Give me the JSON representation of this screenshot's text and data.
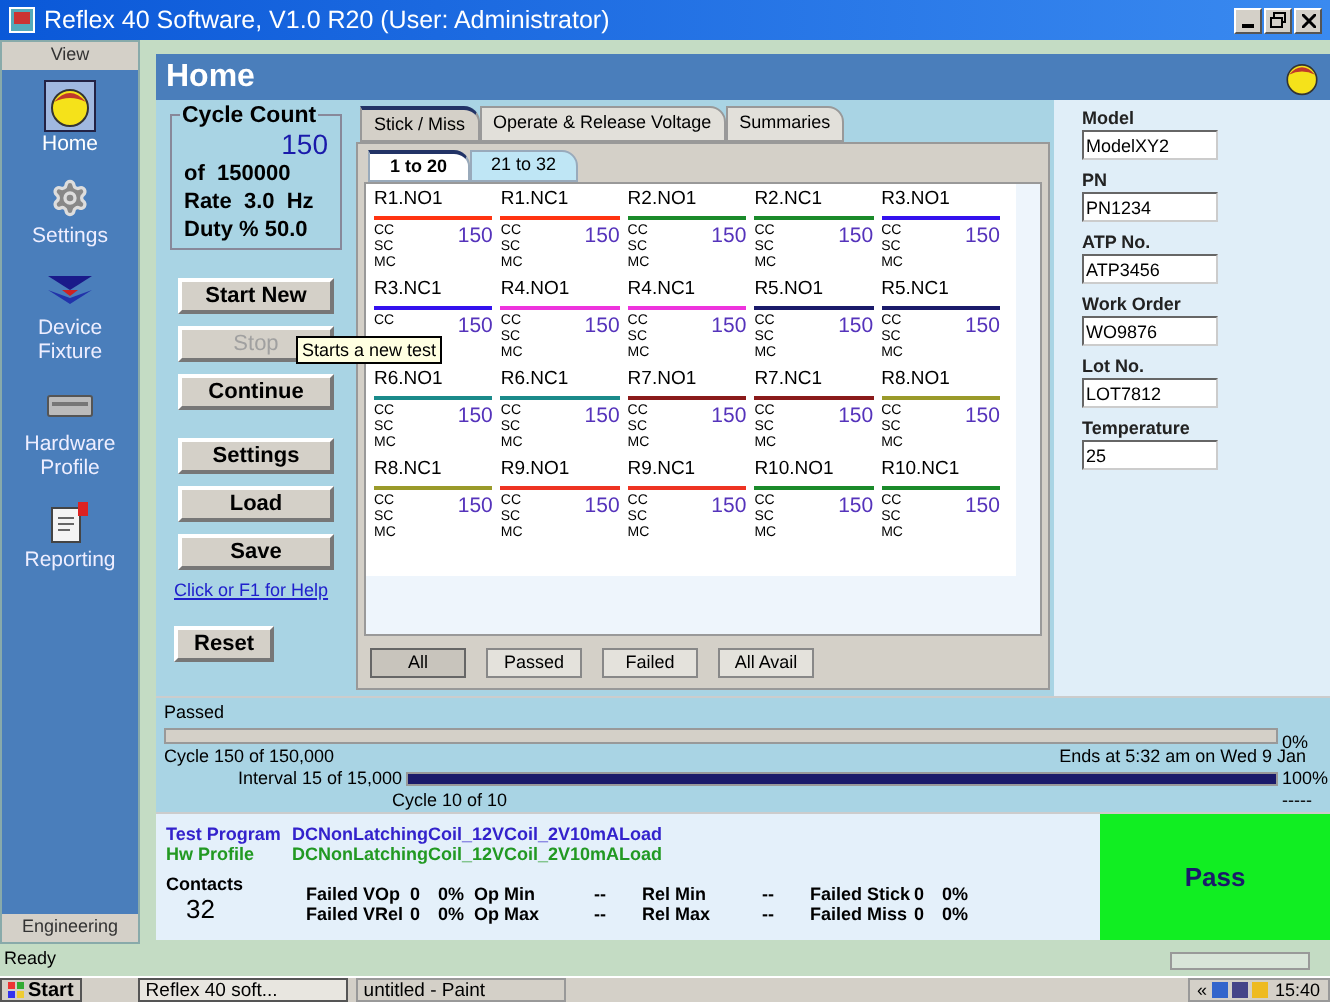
{
  "window": {
    "title": "Reflex 40 Software, V1.0 R20 (User: Administrator)"
  },
  "sidebar": {
    "header": "View",
    "items": [
      {
        "label": "Home",
        "kind": "head",
        "selected": true
      },
      {
        "label": "Settings",
        "kind": "gear",
        "selected": false
      },
      {
        "label": "Device Fixture",
        "kind": "fixture",
        "selected": false
      },
      {
        "label": "Hardware Profile",
        "kind": "hardware",
        "selected": false
      },
      {
        "label": "Reporting",
        "kind": "report",
        "selected": false
      }
    ],
    "footer": "Engineering"
  },
  "page_title": "Home",
  "cycle_count": {
    "title": "Cycle Count",
    "value": "150",
    "of": "of  150000",
    "rate": "Rate  3.0  Hz",
    "duty": "Duty % 50.0"
  },
  "run_buttons": [
    {
      "label": "Start New",
      "disabled": false
    },
    {
      "label": "Stop",
      "disabled": true
    },
    {
      "label": "Continue",
      "disabled": false
    }
  ],
  "file_buttons": [
    {
      "label": "Settings",
      "disabled": false
    },
    {
      "label": "Load",
      "disabled": false
    },
    {
      "label": "Save",
      "disabled": false
    }
  ],
  "help_link": "Click or F1 for Help",
  "reset_button": "Reset",
  "tooltip": "Starts a new test",
  "tabs": [
    {
      "label": "Stick / Miss",
      "selected": true
    },
    {
      "label": "Operate & Release Voltage",
      "selected": false
    },
    {
      "label": "Summaries",
      "selected": false
    }
  ],
  "subtabs": [
    {
      "label": "1 to 20",
      "selected": true
    },
    {
      "label": "21 to 32",
      "selected": false
    }
  ],
  "contacts": [
    {
      "name": "R1.NO1",
      "color": "#ff3311",
      "value": "150",
      "labels": [
        "CC",
        "SC",
        "MC"
      ]
    },
    {
      "name": "R1.NC1",
      "color": "#ff3311",
      "value": "150",
      "labels": [
        "CC",
        "SC",
        "MC"
      ]
    },
    {
      "name": "R2.NO1",
      "color": "#1a8a2a",
      "value": "150",
      "labels": [
        "CC",
        "SC",
        "MC"
      ]
    },
    {
      "name": "R2.NC1",
      "color": "#1a8a2a",
      "value": "150",
      "labels": [
        "CC",
        "SC",
        "MC"
      ]
    },
    {
      "name": "R3.NO1",
      "color": "#3311ee",
      "value": "150",
      "labels": [
        "CC",
        "SC",
        "MC"
      ]
    },
    {
      "name": "R3.NC1",
      "color": "#3311ee",
      "value": "150",
      "labels": [
        "CC"
      ]
    },
    {
      "name": "R4.NO1",
      "color": "#ee33dd",
      "value": "150",
      "labels": [
        "CC",
        "SC",
        "MC"
      ]
    },
    {
      "name": "R4.NC1",
      "color": "#ee33dd",
      "value": "150",
      "labels": [
        "CC",
        "SC",
        "MC"
      ]
    },
    {
      "name": "R5.NO1",
      "color": "#1a1a6a",
      "value": "150",
      "labels": [
        "CC",
        "SC",
        "MC"
      ]
    },
    {
      "name": "R5.NC1",
      "color": "#1a1a6a",
      "value": "150",
      "labels": [
        "CC",
        "SC",
        "MC"
      ]
    },
    {
      "name": "R6.NO1",
      "color": "#1a8a8a",
      "value": "150",
      "labels": [
        "CC",
        "SC",
        "MC"
      ]
    },
    {
      "name": "R6.NC1",
      "color": "#1a8a8a",
      "value": "150",
      "labels": [
        "CC",
        "SC",
        "MC"
      ]
    },
    {
      "name": "R7.NO1",
      "color": "#8a1a1a",
      "value": "150",
      "labels": [
        "CC",
        "SC",
        "MC"
      ]
    },
    {
      "name": "R7.NC1",
      "color": "#8a1a1a",
      "value": "150",
      "labels": [
        "CC",
        "SC",
        "MC"
      ]
    },
    {
      "name": "R8.NO1",
      "color": "#9a9a2a",
      "value": "150",
      "labels": [
        "CC",
        "SC",
        "MC"
      ]
    },
    {
      "name": "R8.NC1",
      "color": "#9a9a2a",
      "value": "150",
      "labels": [
        "CC",
        "SC",
        "MC"
      ]
    },
    {
      "name": "R9.NO1",
      "color": "#ee3322",
      "value": "150",
      "labels": [
        "CC",
        "SC",
        "MC"
      ]
    },
    {
      "name": "R9.NC1",
      "color": "#ee3322",
      "value": "150",
      "labels": [
        "CC",
        "SC",
        "MC"
      ]
    },
    {
      "name": "R10.NO1",
      "color": "#1a8a2a",
      "value": "150",
      "labels": [
        "CC",
        "SC",
        "MC"
      ]
    },
    {
      "name": "R10.NC1",
      "color": "#1a8a2a",
      "value": "150",
      "labels": [
        "CC",
        "SC",
        "MC"
      ]
    }
  ],
  "filters": [
    {
      "label": "All",
      "selected": true
    },
    {
      "label": "Passed",
      "selected": false
    },
    {
      "label": "Failed",
      "selected": false
    },
    {
      "label": "All Avail",
      "selected": false
    }
  ],
  "fields": [
    {
      "label": "Model",
      "value": "ModelXY2"
    },
    {
      "label": "PN",
      "value": "PN1234"
    },
    {
      "label": "ATP No.",
      "value": "ATP3456"
    },
    {
      "label": "Work Order",
      "value": "WO9876"
    },
    {
      "label": "Lot No.",
      "value": "LOT7812"
    },
    {
      "label": "Temperature",
      "value": "25"
    }
  ],
  "progress": {
    "status": "Passed",
    "overall": {
      "level": 0,
      "reading": "0%"
    },
    "cycle": "Cycle 150 of 150,000",
    "ends": "Ends at 5:32 am on Wed 9 Jan",
    "interval": "Interval 15 of 15,000",
    "interval_bar": {
      "level": 1,
      "reading": "100%"
    },
    "sub_cycle": "Cycle 10 of 10",
    "sub_reading": "-----"
  },
  "summary": {
    "test_program_label": "Test Program",
    "test_program": "DCNonLatchingCoil_12VCoil_2V10mALoad",
    "hw_profile_label": "Hw Profile",
    "hw_profile": "DCNonLatchingCoil_12VCoil_2V10mALoad",
    "contacts_label": "Contacts",
    "contacts": "32",
    "stats": [
      [
        {
          "label": "Failed VOp",
          "a": "0",
          "b": "0%"
        },
        {
          "label": "Op Min",
          "a": "--"
        },
        {
          "label": "Rel Min",
          "a": "--"
        },
        {
          "label": "Failed Stick",
          "a": "0",
          "b": "0%"
        }
      ],
      [
        {
          "label": "Failed VRel",
          "a": "0",
          "b": "0%"
        },
        {
          "label": "Op Max",
          "a": "--"
        },
        {
          "label": "Rel Max",
          "a": "--"
        },
        {
          "label": "Failed Miss",
          "a": "0",
          "b": "0%"
        }
      ]
    ]
  },
  "result": "Pass",
  "status_bar": "Ready",
  "status_progress": {
    "level": 0
  },
  "taskbar": {
    "start": "Start",
    "tasks": [
      {
        "label": "Reflex 40 soft...",
        "selected": true
      },
      {
        "label": "untitled - Paint",
        "selected": false
      }
    ],
    "tray_arrow": "«",
    "clock": "15:40"
  }
}
